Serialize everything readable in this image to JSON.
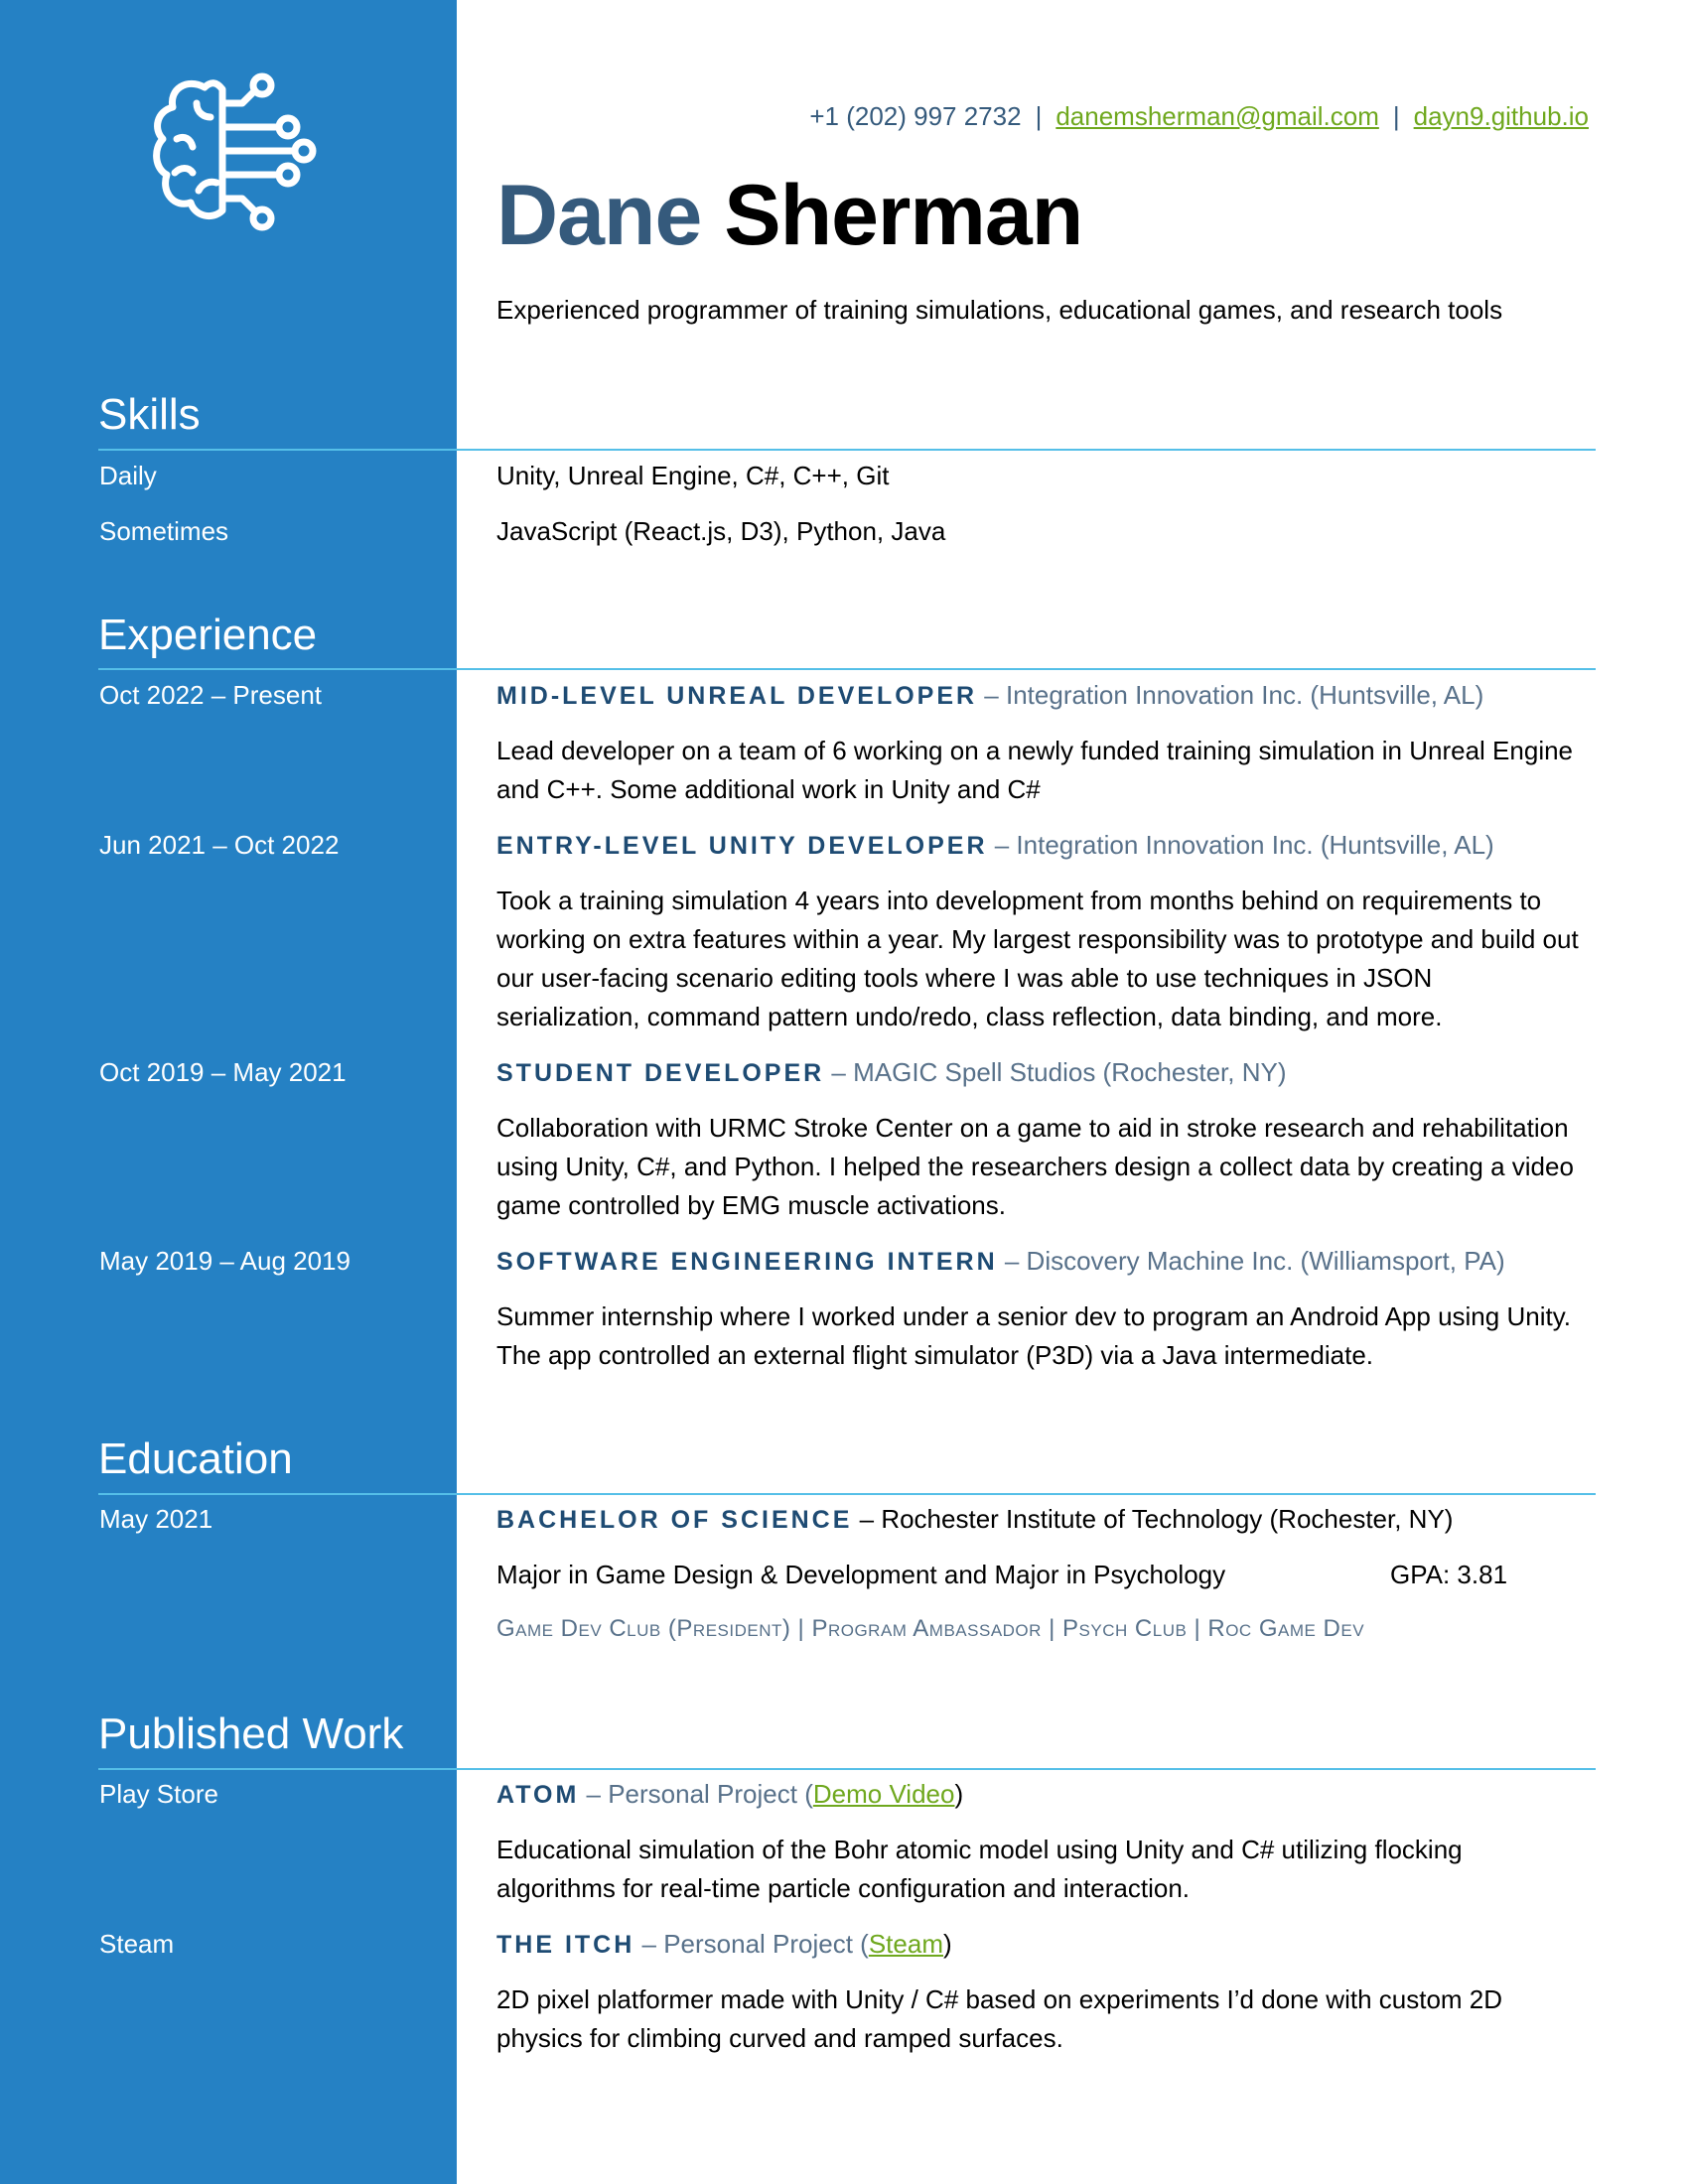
{
  "header": {
    "phone": "+1 (202) 997 2732",
    "separator": "|",
    "email": "danemsherman@gmail.com",
    "website": "dayn9.github.io",
    "first_name": "Dane",
    "last_name": "Sherman",
    "tagline": "Experienced programmer of training simulations, educational games, and research tools",
    "logo_icon": "brain-circuit-icon"
  },
  "skills": {
    "title": "Skills",
    "rows": [
      {
        "label": "Daily",
        "value": "Unity, Unreal Engine, C#, C++, Git"
      },
      {
        "label": "Sometimes",
        "value": "JavaScript (React.js, D3), Python, Java"
      }
    ]
  },
  "experience": {
    "title": "Experience",
    "jobs": [
      {
        "dates": "Oct 2022 – Present",
        "title": "MID-LEVEL UNREAL DEVELOPER",
        "org": " – Integration Innovation Inc. (Huntsville, AL)",
        "description": "Lead developer on a team of 6 working on a newly funded training simulation in Unreal Engine and C++. Some additional work in Unity and C#"
      },
      {
        "dates": "Jun 2021 – Oct 2022",
        "title": "ENTRY-LEVEL UNITY DEVELOPER",
        "org": " – Integration Innovation Inc. (Huntsville, AL)",
        "description": "Took a training simulation 4 years into development from months behind on requirements to working on extra features within a year. My largest responsibility was to prototype and build out our user-facing scenario editing tools where I was able to use techniques in JSON serialization, command pattern undo/redo, class reflection, data binding, and more."
      },
      {
        "dates": "Oct 2019 – May 2021",
        "title": "STUDENT DEVELOPER",
        "org": " – MAGIC Spell Studios (Rochester, NY)",
        "description": "Collaboration with URMC Stroke Center on a game to aid in stroke research and rehabilitation using Unity, C#, and Python. I helped the researchers design a collect data by creating a video game controlled by EMG muscle activations."
      },
      {
        "dates": "May 2019 – Aug 2019",
        "title": "SOFTWARE ENGINEERING INTERN",
        "org": " – Discovery Machine Inc. (Williamsport, PA)",
        "description": "Summer internship where I worked under a senior dev to program an Android App using Unity. The app controlled an external flight simulator (P3D) via a Java intermediate."
      }
    ]
  },
  "education": {
    "title": "Education",
    "date": "May 2021",
    "degree": "BACHELOR OF SCIENCE",
    "school": " – Rochester Institute of Technology (Rochester, NY)",
    "majors": "Major in Game Design & Development and Major in Psychology",
    "gpa": "GPA: 3.81",
    "clubs": "Game Dev Club (President) | Program Ambassador | Psych Club | Roc Game Dev"
  },
  "published": {
    "title": "Published Work",
    "items": [
      {
        "label": "Play Store",
        "title": "ATOM",
        "org_prefix": " – Personal Project (",
        "link": "Demo Video",
        "org_suffix": ")",
        "description": "Educational simulation of the Bohr atomic model using Unity and C# utilizing flocking algorithms for real-time particle configuration and interaction."
      },
      {
        "label": "Steam",
        "title": "THE ITCH",
        "org_prefix": " – Personal Project (",
        "link": "Steam",
        "org_suffix": ")",
        "description": "2D pixel platformer made with Unity / C# based on experiments I’d done with custom 2D physics for climbing curved and ramped surfaces."
      }
    ]
  },
  "colors": {
    "sidebar": "#2581c4",
    "rule": "#55bfe8",
    "first_name": "#355a7c",
    "job_title": "#1e4b73",
    "org_text": "#58718a",
    "link": "#6fa81e"
  }
}
